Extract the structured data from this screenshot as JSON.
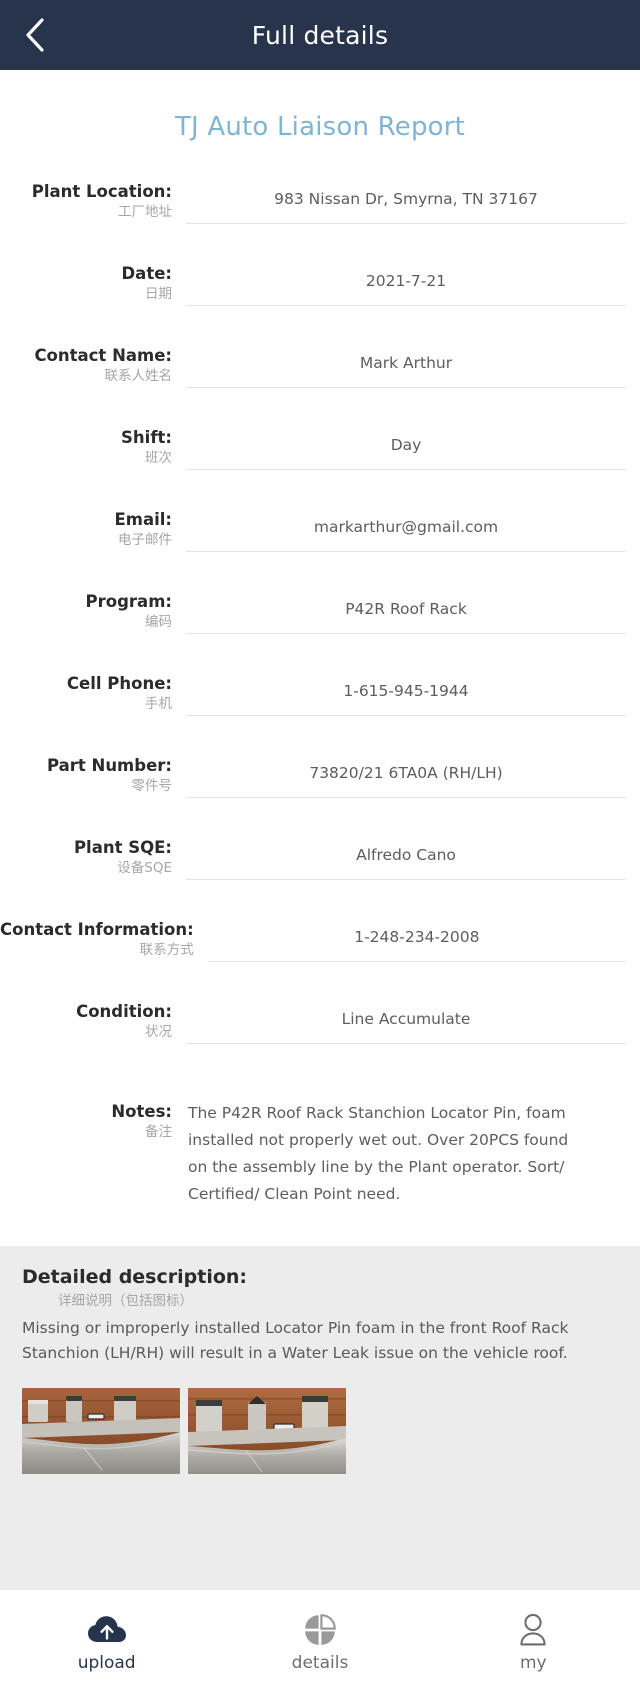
{
  "header": {
    "title": "Full details",
    "back_icon": "chevron-left-icon",
    "bg_color": "#27344b"
  },
  "report": {
    "title": "TJ Auto Liaison Report",
    "title_color": "#7fb4d4"
  },
  "fields": [
    {
      "label_en": "Plant Location:",
      "label_cn": "工厂地址",
      "value": "983 Nissan Dr, Smyrna, TN 37167"
    },
    {
      "label_en": "Date:",
      "label_cn": "日期",
      "value": "2021-7-21"
    },
    {
      "label_en": "Contact Name:",
      "label_cn": "联系人姓名",
      "value": "Mark Arthur"
    },
    {
      "label_en": "Shift:",
      "label_cn": "班次",
      "value": "Day"
    },
    {
      "label_en": "Email:",
      "label_cn": "电子邮件",
      "value": "markarthur@gmail.com"
    },
    {
      "label_en": "Program:",
      "label_cn": "编码",
      "value": "P42R Roof Rack"
    },
    {
      "label_en": "Cell Phone:",
      "label_cn": "手机",
      "value": "1-615-945-1944"
    },
    {
      "label_en": "Part Number:",
      "label_cn": "零件号",
      "value": "73820/21 6TA0A (RH/LH)"
    },
    {
      "label_en": "Plant SQE:",
      "label_cn": "设备SQE",
      "value": "Alfredo Cano"
    },
    {
      "label_en": "Contact Information:",
      "label_cn": "联系方式",
      "value": "1-248-234-2008"
    },
    {
      "label_en": "Condition:",
      "label_cn": "状况",
      "value": "Line Accumulate"
    }
  ],
  "notes": {
    "label_en": "Notes:",
    "label_cn": "备注",
    "text": "The P42R Roof Rack Stanchion Locator Pin, foam installed not properly wet out. Over 20PCS found on the assembly line by the Plant operator. Sort/ Certified/ Clean Point need."
  },
  "detail": {
    "heading_en": "Detailed description:",
    "heading_cn": "详细说明（包括图标）",
    "text": "Missing or improperly installed Locator Pin foam in the front Roof Rack Stanchion (LH/RH) will result in a Water Leak issue on the vehicle roof.",
    "photos": [
      {
        "alt": "roof-rack-stanchion-photo-1"
      },
      {
        "alt": "roof-rack-stanchion-photo-2"
      }
    ],
    "bg_color": "#ececec"
  },
  "tabbar": {
    "items": [
      {
        "label": "upload",
        "icon": "cloud-upload-icon",
        "active": true
      },
      {
        "label": "details",
        "icon": "grid-petals-icon",
        "active": false
      },
      {
        "label": "my",
        "icon": "person-outline-icon",
        "active": false
      }
    ],
    "active_color": "#27344b",
    "idle_color": "#9a9a9a"
  }
}
